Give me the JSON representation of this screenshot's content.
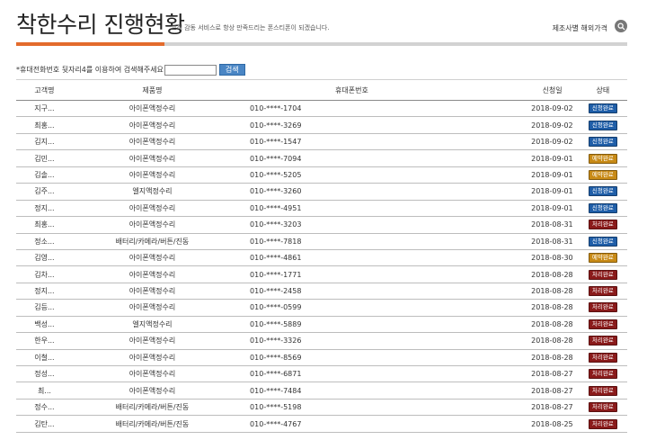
{
  "header": {
    "title": "착한수리 진행현황",
    "subtitle": "고객 감동 서비스로 항상 만족드리는 폰스티폰이 되겠습니다.",
    "brand_link": "제조사별 해외가격"
  },
  "search": {
    "label": "*휴대전화번호 뒷자리4를 이용하여 검색해주세요",
    "value": "",
    "button": "검색"
  },
  "table": {
    "headers": {
      "name": "고객명",
      "product": "제품명",
      "phone": "휴대폰번호",
      "date": "신청일",
      "status": "상태"
    },
    "rows": [
      {
        "name": "지구...",
        "product": "아이폰액정수리",
        "phone": "010-****-1704",
        "date": "2018-09-02",
        "status": "신청완료",
        "kind": "blue"
      },
      {
        "name": "최홍...",
        "product": "아이폰액정수리",
        "phone": "010-****-3269",
        "date": "2018-09-02",
        "status": "신청완료",
        "kind": "blue"
      },
      {
        "name": "김지...",
        "product": "아이폰액정수리",
        "phone": "010-****-1547",
        "date": "2018-09-02",
        "status": "신청완료",
        "kind": "blue"
      },
      {
        "name": "김민...",
        "product": "아이폰액정수리",
        "phone": "010-****-7094",
        "date": "2018-09-01",
        "status": "예약완료",
        "kind": "gold"
      },
      {
        "name": "김솔...",
        "product": "아이폰액정수리",
        "phone": "010-****-5205",
        "date": "2018-09-01",
        "status": "예약완료",
        "kind": "gold"
      },
      {
        "name": "김주...",
        "product": "엘지액정수리",
        "phone": "010-****-3260",
        "date": "2018-09-01",
        "status": "신청완료",
        "kind": "blue"
      },
      {
        "name": "정지...",
        "product": "아이폰액정수리",
        "phone": "010-****-4951",
        "date": "2018-09-01",
        "status": "신청완료",
        "kind": "blue"
      },
      {
        "name": "최홍...",
        "product": "아이폰액정수리",
        "phone": "010-****-3203",
        "date": "2018-08-31",
        "status": "처리완료",
        "kind": "red"
      },
      {
        "name": "정소...",
        "product": "배터리/카메라/버튼/진동",
        "phone": "010-****-7818",
        "date": "2018-08-31",
        "status": "신청완료",
        "kind": "blue"
      },
      {
        "name": "김영...",
        "product": "아이폰액정수리",
        "phone": "010-****-4861",
        "date": "2018-08-30",
        "status": "예약완료",
        "kind": "gold"
      },
      {
        "name": "김차...",
        "product": "아이폰액정수리",
        "phone": "010-****-1771",
        "date": "2018-08-28",
        "status": "처리완료",
        "kind": "red"
      },
      {
        "name": "정지...",
        "product": "아이폰액정수리",
        "phone": "010-****-2458",
        "date": "2018-08-28",
        "status": "처리완료",
        "kind": "red"
      },
      {
        "name": "김등...",
        "product": "아이폰액정수리",
        "phone": "010-****-0599",
        "date": "2018-08-28",
        "status": "처리완료",
        "kind": "red"
      },
      {
        "name": "백성...",
        "product": "엘지액정수리",
        "phone": "010-****-5889",
        "date": "2018-08-28",
        "status": "처리완료",
        "kind": "red"
      },
      {
        "name": "한우...",
        "product": "아이폰액정수리",
        "phone": "010-****-3326",
        "date": "2018-08-28",
        "status": "처리완료",
        "kind": "red"
      },
      {
        "name": "이철...",
        "product": "아이폰액정수리",
        "phone": "010-****-8569",
        "date": "2018-08-28",
        "status": "처리완료",
        "kind": "red"
      },
      {
        "name": "정성...",
        "product": "아이폰액정수리",
        "phone": "010-****-6871",
        "date": "2018-08-27",
        "status": "처리완료",
        "kind": "red"
      },
      {
        "name": "최...",
        "product": "아이폰액정수리",
        "phone": "010-****-7484",
        "date": "2018-08-27",
        "status": "처리완료",
        "kind": "red"
      },
      {
        "name": "정수...",
        "product": "배터리/카메라/버튼/진동",
        "phone": "010-****-5198",
        "date": "2018-08-27",
        "status": "처리완료",
        "kind": "red"
      },
      {
        "name": "김탄...",
        "product": "배터리/카메라/버튼/진동",
        "phone": "010-****-4767",
        "date": "2018-08-25",
        "status": "처리완료",
        "kind": "red"
      }
    ]
  },
  "colors": {
    "accent": "#e36b2c",
    "badge_blue": "#1f5ea8",
    "badge_gold": "#c88a16",
    "badge_red": "#8a1a1a",
    "button": "#4a86c5"
  },
  "icons": {
    "search": "search-icon"
  }
}
